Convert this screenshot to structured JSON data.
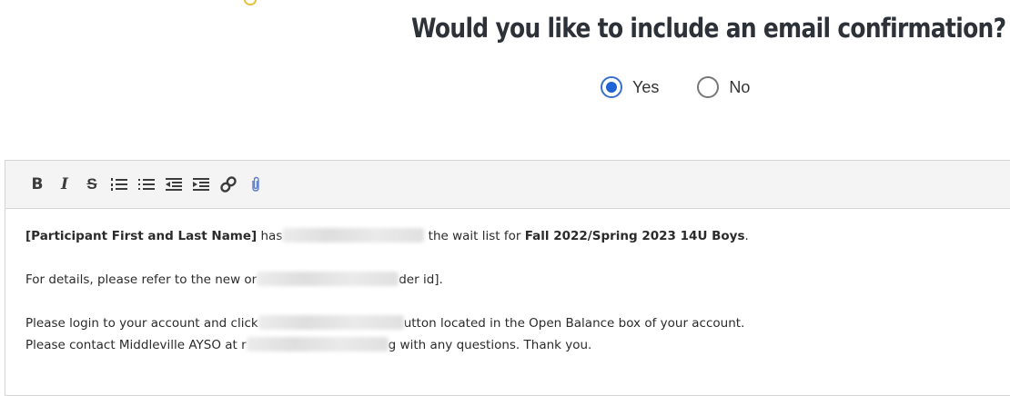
{
  "question": {
    "title": "Would you like to include an email confirmation?"
  },
  "radio": {
    "options": [
      {
        "label": "Yes",
        "checked": true
      },
      {
        "label": "No",
        "checked": false
      }
    ],
    "accent_color": "#1f63d6"
  },
  "toolbar": {
    "tools": [
      {
        "name": "bold",
        "glyph": "B"
      },
      {
        "name": "italic",
        "glyph": "I"
      },
      {
        "name": "strikethrough",
        "glyph": "S"
      },
      {
        "name": "ordered-list",
        "glyph": "ordered-list-icon"
      },
      {
        "name": "bullet-list",
        "glyph": "bullet-list-icon"
      },
      {
        "name": "outdent",
        "glyph": "outdent-icon"
      },
      {
        "name": "indent",
        "glyph": "indent-icon"
      },
      {
        "name": "link",
        "glyph": "link-icon"
      },
      {
        "name": "attachment",
        "glyph": "paperclip-icon"
      }
    ]
  },
  "body": {
    "line1": {
      "bold_prefix": "[Participant First and Last Name]",
      "text_a": " has",
      "text_b": " the wait list for ",
      "bold_suffix": "Fall 2022/Spring 2023 14U Boys",
      "end": "."
    },
    "line2": {
      "text_a": "For details, please refer to the new or",
      "text_b": "der id]."
    },
    "line3": {
      "text_a": "Please login to your account and click",
      "text_b": "utton located in the Open Balance box of your account."
    },
    "line4": {
      "text_a": "Please contact Middleville AYSO at r",
      "text_b": "g with any questions. Thank you."
    }
  }
}
